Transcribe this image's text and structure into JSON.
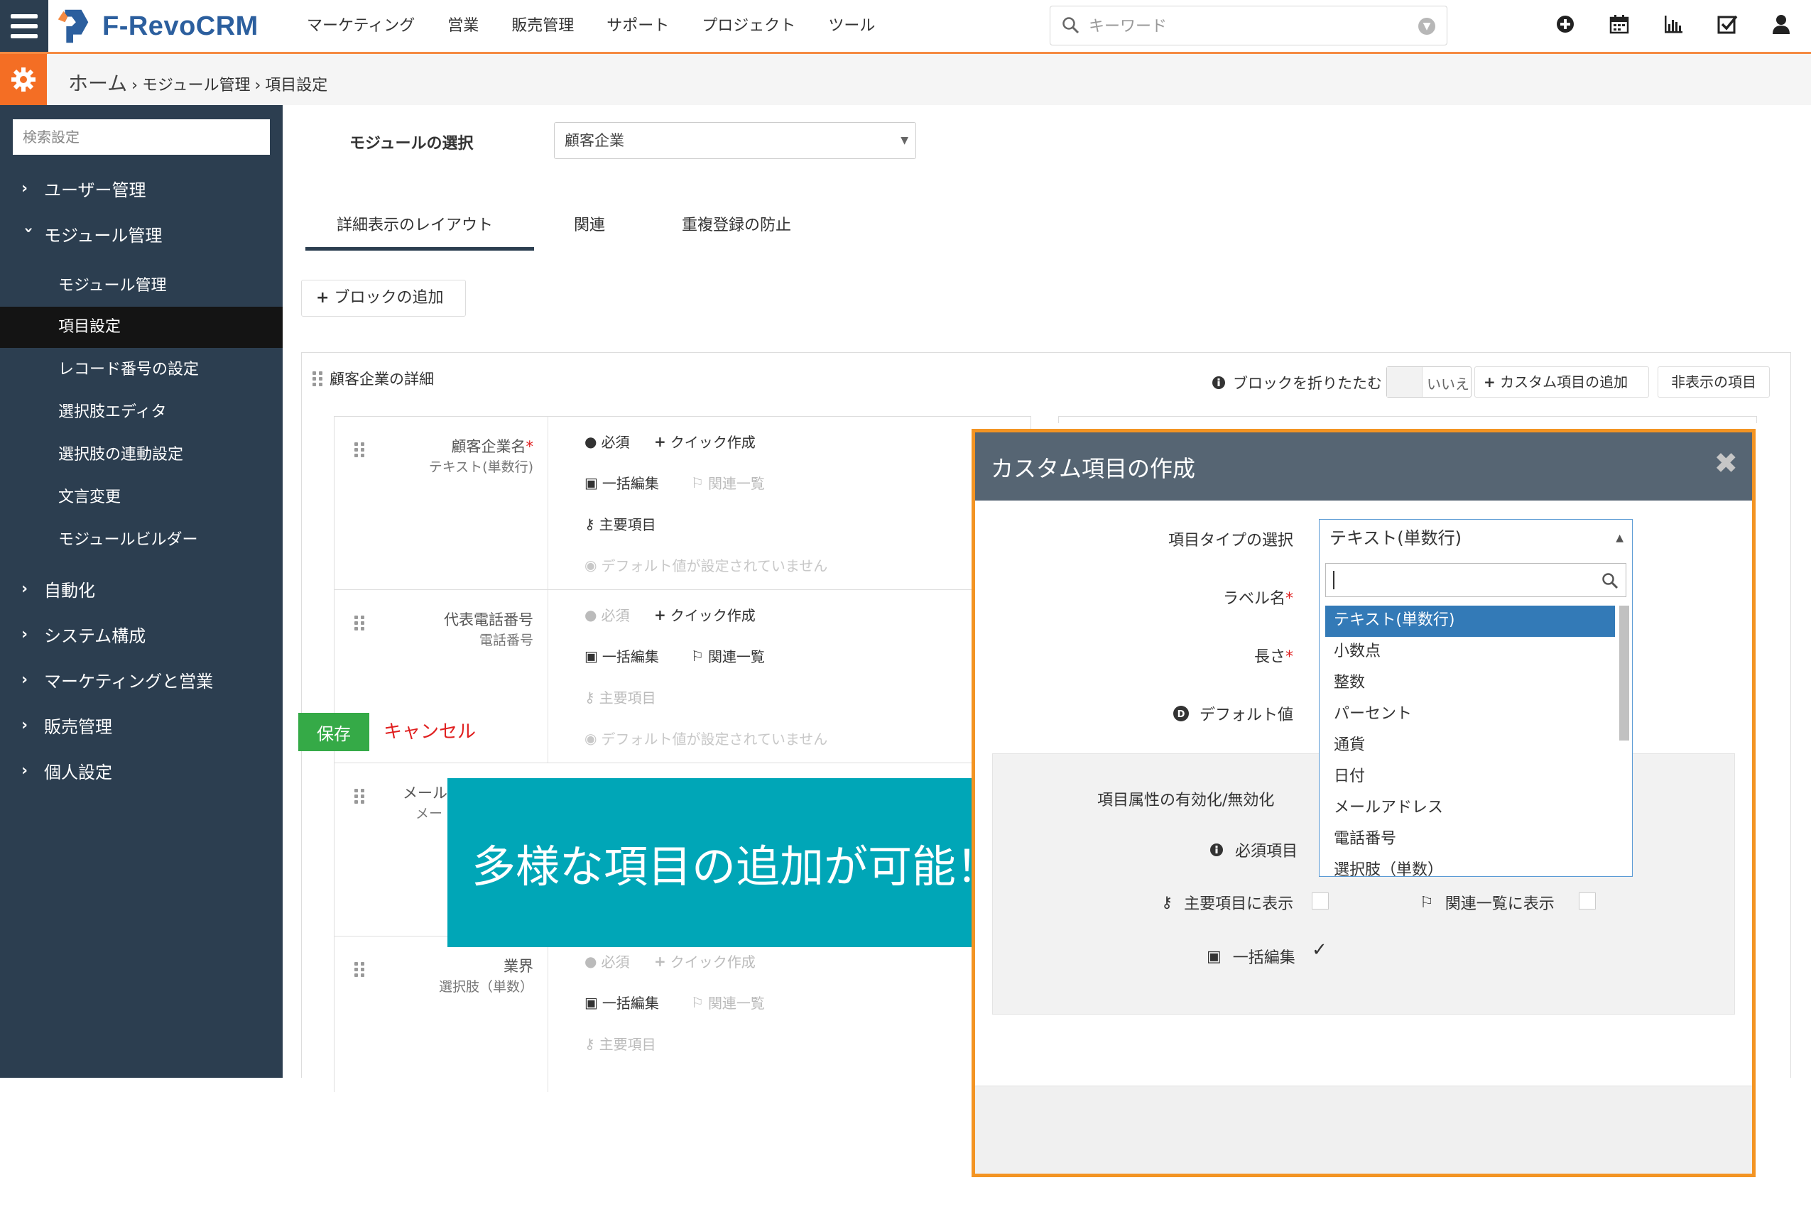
{
  "app": {
    "brand": "F-RevoCRM",
    "menu": [
      "マーケティング",
      "営業",
      "販売管理",
      "サポート",
      "プロジェクト",
      "ツール"
    ],
    "search_placeholder": "キーワード",
    "top_icons": [
      "plus-circle-icon",
      "calendar-icon",
      "bar-chart-icon",
      "checkbox-icon",
      "user-icon"
    ]
  },
  "breadcrumb": {
    "home": "ホーム",
    "sep1": "›",
    "level1": "モジュール管理",
    "sep2": "›",
    "level2": "項目設定"
  },
  "sidebar": {
    "search_placeholder": "検索設定",
    "users": "ユーザー管理",
    "modules": "モジュール管理",
    "sub_items": [
      "モジュール管理",
      "項目設定",
      "レコード番号の設定",
      "選択肢エディタ",
      "選択肢の連動設定",
      "文言変更",
      "モジュールビルダー"
    ],
    "active_index": 1,
    "others": [
      "自動化",
      "システム構成",
      "マーケティングと営業",
      "販売管理",
      "個人設定"
    ]
  },
  "content": {
    "module_label": "モジュールの選択",
    "module_selected": "顧客企業",
    "tabs": [
      "詳細表示のレイアウト",
      "関連",
      "重複登録の防止"
    ],
    "active_tab": 0,
    "add_block": "ブロックの追加",
    "block_title": "顧客企業の詳細",
    "fold_label": "ブロックを折りたたむ",
    "fold_value": "いいえ",
    "add_custom": "カスタム項目の追加",
    "hidden_items": "非表示の項目"
  },
  "props": {
    "required": "必須",
    "quick_create": "クイック作成",
    "mass_edit": "一括編集",
    "related_list": "関連一覧",
    "key_field": "主要項目",
    "no_default": "デフォルト値が設定されていません"
  },
  "fields": [
    {
      "name": "顧客企業名",
      "type": "テキスト(単数行)",
      "required_mark": "*"
    },
    {
      "name": "代表電話番号",
      "type": "電話番号",
      "required_mark": ""
    },
    {
      "name": "メール",
      "type": "メー",
      "required_mark": ""
    },
    {
      "name": "業界",
      "type": "選択肢（単数）",
      "required_mark": ""
    }
  ],
  "callout": {
    "text": "多様な項目の追加が可能！",
    "color": "#00a6b7"
  },
  "modal": {
    "title": "カスタム項目の作成",
    "type_label": "項目タイプの選択",
    "type_selected": "テキスト(単数行)",
    "label_label": "ラベル名",
    "length_label": "長さ",
    "default_label": "デフォルト値",
    "required_mark": "*",
    "options": [
      "テキスト(単数行)",
      "小数点",
      "整数",
      "パーセント",
      "通貨",
      "日付",
      "メールアドレス",
      "電話番号",
      "選択肢（単数）"
    ],
    "selected_option_index": 0,
    "attr_title": "項目属性の有効化/無効化",
    "attr_required": "必須項目",
    "attr_key": "主要項目に表示",
    "attr_related": "関連一覧に表示",
    "attr_mass": "一括編集",
    "attr_mass_checked": true,
    "save": "保存",
    "cancel": "キャンセル",
    "border_color": "#f39423"
  },
  "colors": {
    "sidebar_bg": "#2c3e50",
    "accent_orange": "#f58a42",
    "gear_bg": "#f46e24",
    "save_green": "#35aa47",
    "cancel_red": "#e02020",
    "select_blue": "#337ab7"
  }
}
